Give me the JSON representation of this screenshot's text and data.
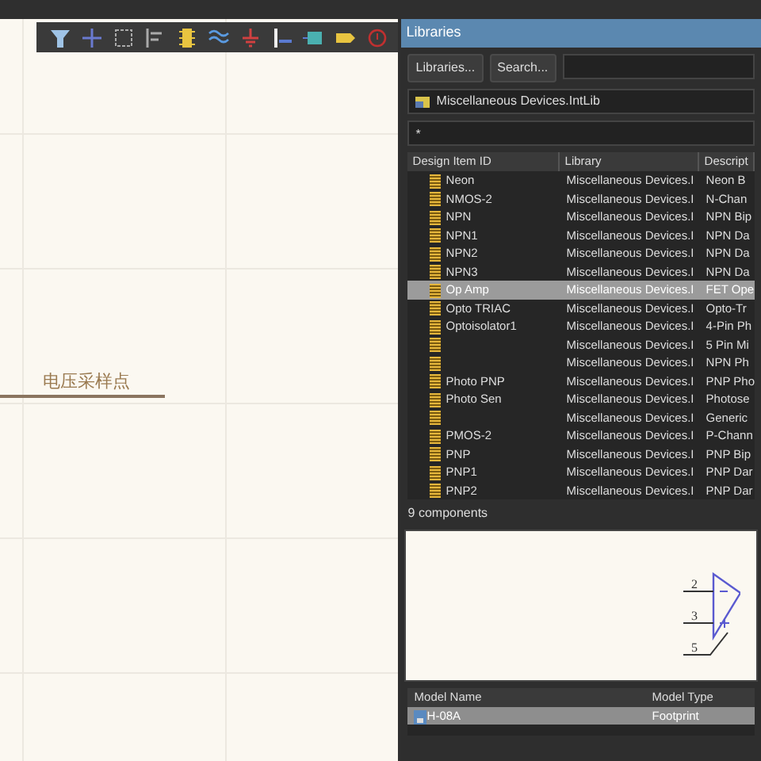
{
  "canvas": {
    "label": "电压采样点"
  },
  "libraries": {
    "title": "Libraries",
    "buttons": [
      "Libraries...",
      "Search..."
    ],
    "library": "Miscellaneous Devices.IntLib",
    "filter": "*",
    "columns": [
      "Design Item ID",
      "Library",
      "Descript"
    ],
    "rows": [
      {
        "id": "Neon",
        "library": "Miscellaneous Devices.I",
        "description": "Neon B",
        "selected": false
      },
      {
        "id": "NMOS-2",
        "library": "Miscellaneous Devices.I",
        "description": "N-Chan",
        "selected": false
      },
      {
        "id": "NPN",
        "library": "Miscellaneous Devices.I",
        "description": "NPN Bip",
        "selected": false
      },
      {
        "id": "NPN1",
        "library": "Miscellaneous Devices.I",
        "description": "NPN Da",
        "selected": false
      },
      {
        "id": "NPN2",
        "library": "Miscellaneous Devices.I",
        "description": "NPN Da",
        "selected": false
      },
      {
        "id": "NPN3",
        "library": "Miscellaneous Devices.I",
        "description": "NPN Da",
        "selected": false
      },
      {
        "id": "Op Amp",
        "library": "Miscellaneous Devices.I",
        "description": "FET Ope",
        "selected": true
      },
      {
        "id": "Opto TRIAC",
        "library": "Miscellaneous Devices.I",
        "description": "Opto-Tr",
        "selected": false
      },
      {
        "id": "Optoisolator1",
        "library": "Miscellaneous Devices.I",
        "description": "4-Pin Ph",
        "selected": false
      },
      {
        "library": "Miscellaneous Devices.I",
        "description": "5 Pin Mi",
        "selected": false
      },
      {
        "library": "Miscellaneous Devices.I",
        "description": "NPN Ph",
        "selected": false
      },
      {
        "id": "Photo PNP",
        "library": "Miscellaneous Devices.I",
        "description": "PNP Pho",
        "selected": false
      },
      {
        "id": "Photo Sen",
        "library": "Miscellaneous Devices.I",
        "description": "Photose",
        "selected": false
      },
      {
        "library": "Miscellaneous Devices.I",
        "description": "Generic",
        "selected": false
      },
      {
        "id": "PMOS-2",
        "library": "Miscellaneous Devices.I",
        "description": "P-Chann",
        "selected": false
      },
      {
        "id": "PNP",
        "library": "Miscellaneous Devices.I",
        "description": "PNP Bip",
        "selected": false
      },
      {
        "id": "PNP1",
        "library": "Miscellaneous Devices.I",
        "description": "PNP Dar",
        "selected": false
      },
      {
        "id": "PNP2",
        "library": "Miscellaneous Devices.I",
        "description": "PNP Dar",
        "selected": false
      }
    ],
    "count": "9 components",
    "preview": {
      "pins": [
        "2",
        "3",
        "5"
      ]
    },
    "model_columns": [
      "Model Name",
      "Model Type"
    ],
    "models": [
      {
        "name": "H-08A",
        "type": "Footprint",
        "selected": true
      }
    ]
  }
}
